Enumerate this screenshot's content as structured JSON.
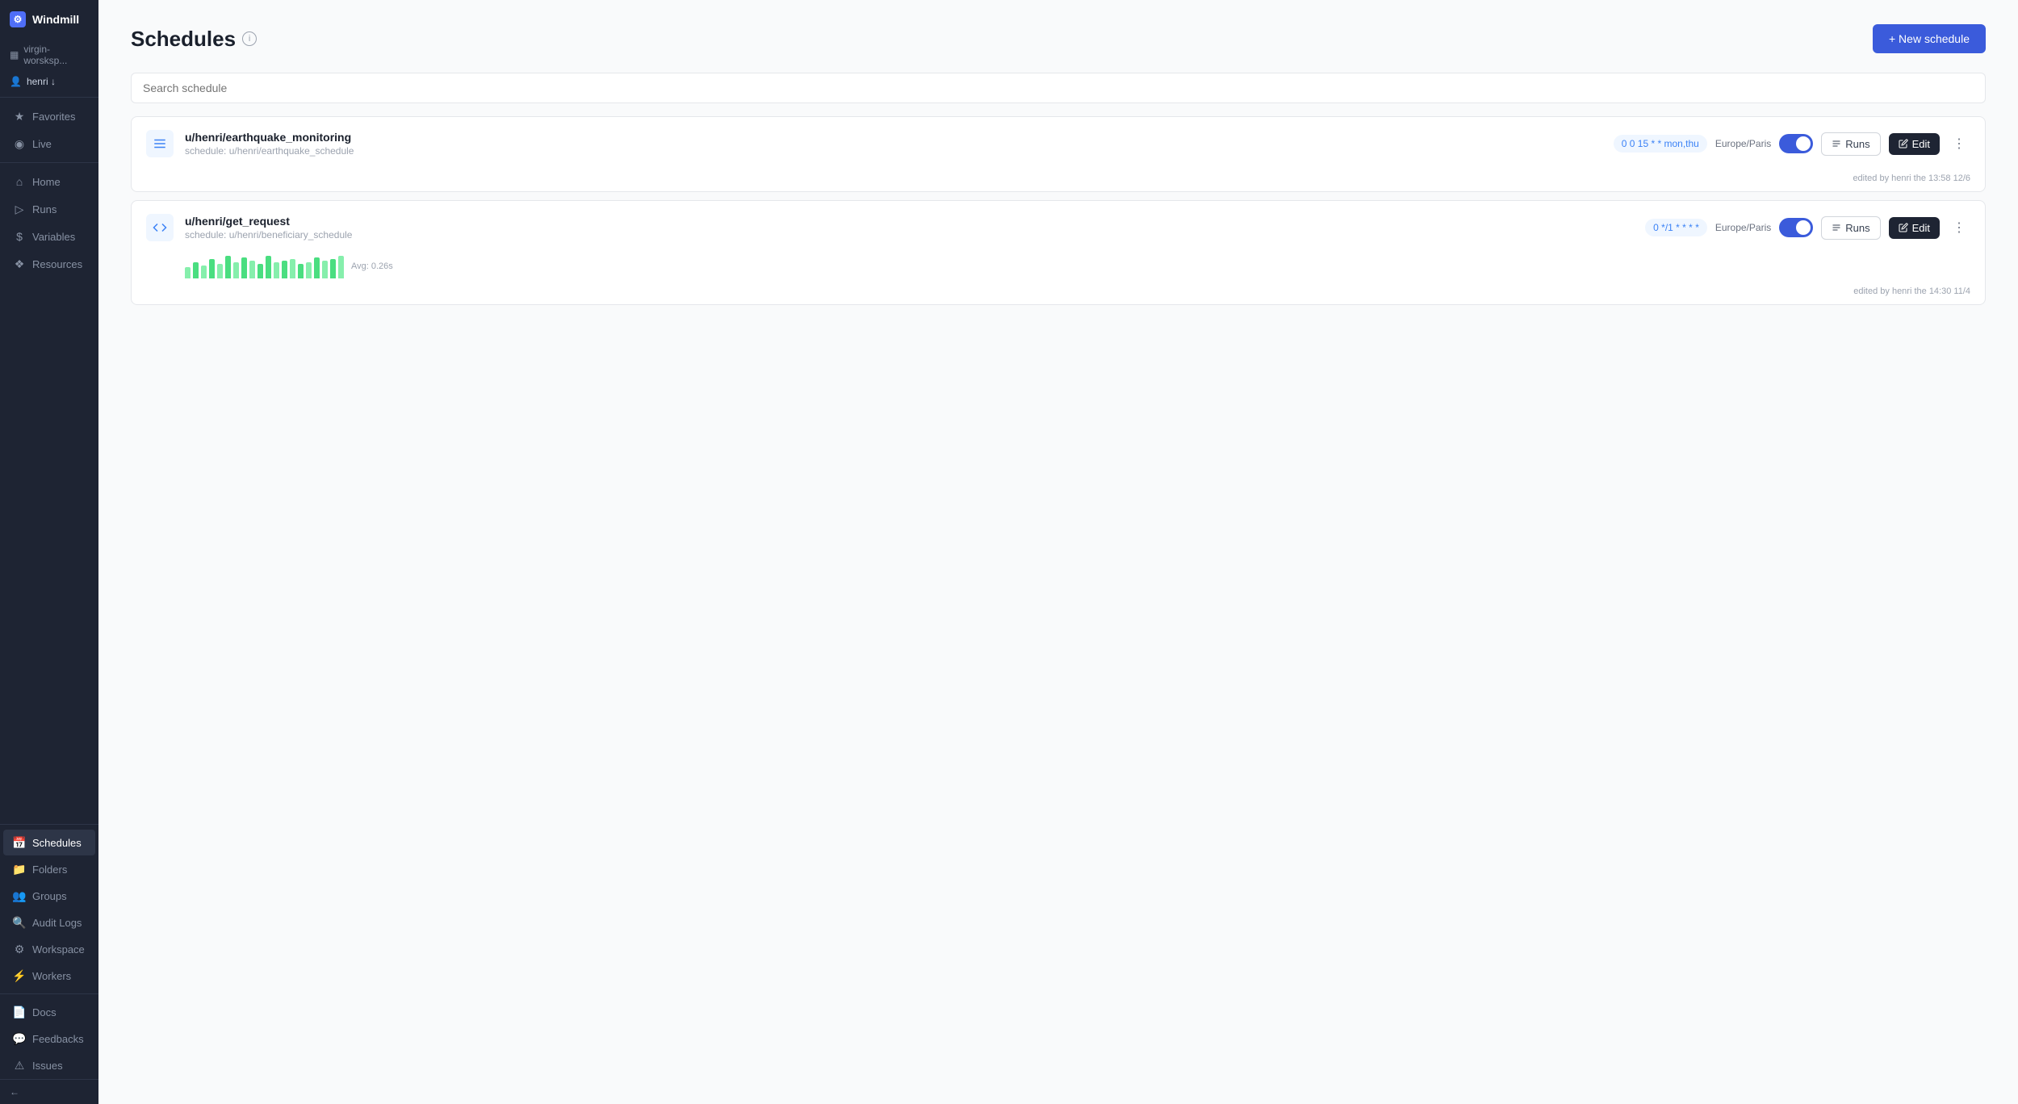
{
  "app": {
    "name": "Windmill"
  },
  "sidebar": {
    "workspace": "virgin-worsksp...",
    "user": "henri ↓",
    "nav_items": [
      {
        "id": "home",
        "label": "Home",
        "icon": "home"
      },
      {
        "id": "runs",
        "label": "Runs",
        "icon": "runs"
      },
      {
        "id": "variables",
        "label": "Variables",
        "icon": "variables"
      },
      {
        "id": "resources",
        "label": "Resources",
        "icon": "resources"
      }
    ],
    "top_items": [
      {
        "id": "favorites",
        "label": "Favorites",
        "icon": "star"
      },
      {
        "id": "live",
        "label": "Live",
        "icon": "live"
      }
    ],
    "bottom_items": [
      {
        "id": "schedules",
        "label": "Schedules",
        "icon": "schedules",
        "active": true
      },
      {
        "id": "folders",
        "label": "Folders",
        "icon": "folders"
      },
      {
        "id": "groups",
        "label": "Groups",
        "icon": "groups"
      },
      {
        "id": "audit-logs",
        "label": "Audit Logs",
        "icon": "audit"
      },
      {
        "id": "workspace",
        "label": "Workspace",
        "icon": "workspace"
      },
      {
        "id": "workers",
        "label": "Workers",
        "icon": "workers"
      }
    ],
    "footer_items": [
      {
        "id": "docs",
        "label": "Docs",
        "icon": "docs"
      },
      {
        "id": "feedbacks",
        "label": "Feedbacks",
        "icon": "feedback"
      },
      {
        "id": "issues",
        "label": "Issues",
        "icon": "issues"
      }
    ]
  },
  "page": {
    "title": "Schedules",
    "new_schedule_label": "+ New schedule",
    "search_placeholder": "Search schedule"
  },
  "schedules": [
    {
      "id": "1",
      "type": "flow",
      "name": "u/henri/earthquake_monitoring",
      "path": "schedule: u/henri/earthquake_schedule",
      "cron": "0 0 15 * * mon,thu",
      "timezone": "Europe/Paris",
      "enabled": true,
      "runs_label": "Runs",
      "edit_label": "Edit",
      "edited_by": "edited by henri the 13:58 12/6",
      "has_chart": false
    },
    {
      "id": "2",
      "type": "script",
      "name": "u/henri/get_request",
      "path": "schedule: u/henri/beneficiary_schedule",
      "cron": "0 */1 * * * *",
      "timezone": "Europe/Paris",
      "enabled": true,
      "runs_label": "Runs",
      "edit_label": "Edit",
      "edited_by": "edited by henri the 14:30 11/4",
      "has_chart": true,
      "avg": "Avg: 0.26s",
      "chart_bars": [
        5,
        8,
        6,
        9,
        7,
        10,
        8,
        11,
        9,
        7,
        12,
        8,
        9,
        10,
        7,
        8,
        11,
        9,
        10,
        12
      ]
    }
  ]
}
